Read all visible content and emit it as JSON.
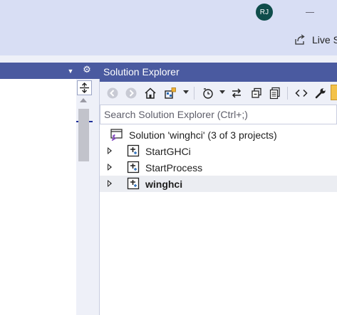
{
  "titlebar": {
    "avatar_initials": "RJ",
    "live_share_label": "Live S"
  },
  "solution_explorer": {
    "title": "Solution Explorer",
    "search_placeholder": "Search Solution Explorer (Ctrl+;)",
    "toolbar_icons": [
      "back-arrow-icon",
      "forward-arrow-icon",
      "home-icon",
      "switch-views-icon",
      "pending-changes-filter-icon",
      "sync-icon",
      "collapse-all-icon",
      "show-all-files-icon",
      "view-code-icon",
      "properties-wrench-icon"
    ],
    "tree": {
      "solution_label": "Solution 'winghci' (3 of 3 projects)",
      "projects": [
        {
          "label": "StartGHCi",
          "selected": false
        },
        {
          "label": "StartProcess",
          "selected": false
        },
        {
          "label": "winghci",
          "selected": true
        }
      ]
    }
  },
  "colors": {
    "header_blue": "#4a5aa0",
    "titlebar_bg": "#d8def4",
    "avatar_bg": "#0f4d4b",
    "accent_line": "#1f2f9a",
    "selection_bg": "#ebedf2"
  }
}
